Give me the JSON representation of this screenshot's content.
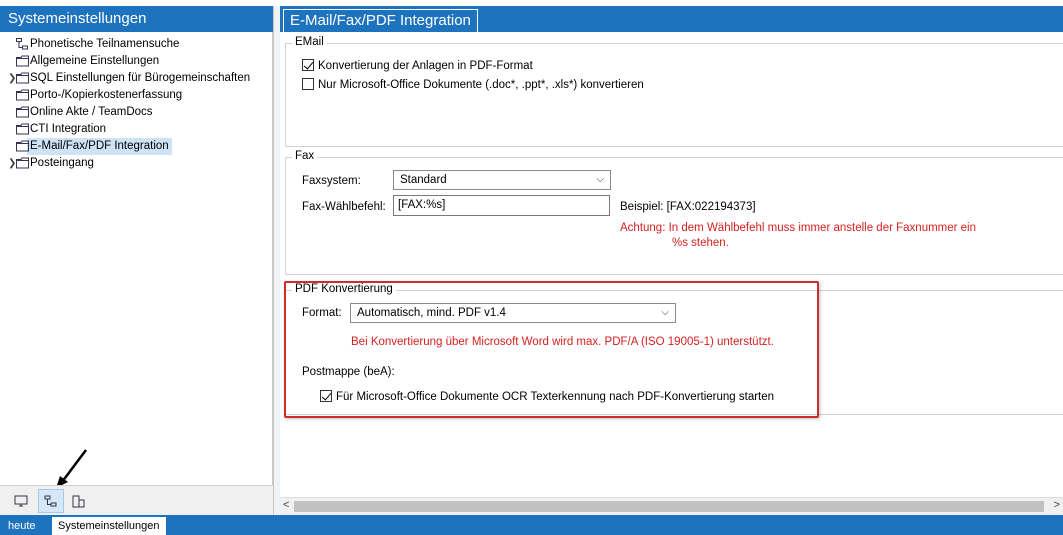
{
  "left": {
    "title": "Systemeinstellungen",
    "tree": [
      {
        "label": "Phonetische Teilnamensuche",
        "icon": "tree-icon",
        "chevron": false
      },
      {
        "label": "Allgemeine Einstellungen",
        "icon": "folder-icon",
        "chevron": false
      },
      {
        "label": "SQL Einstellungen für Bürogemeinschaften",
        "icon": "folder-icon",
        "chevron": true
      },
      {
        "label": "Porto-/Kopierkostenerfassung",
        "icon": "folder-icon",
        "chevron": false
      },
      {
        "label": "Online Akte / TeamDocs",
        "icon": "folder-icon",
        "chevron": false
      },
      {
        "label": "CTI Integration",
        "icon": "folder-icon",
        "chevron": false
      },
      {
        "label": "E-Mail/Fax/PDF Integration",
        "icon": "folder-icon",
        "chevron": false,
        "selected": true
      },
      {
        "label": "Posteingang",
        "icon": "folder-icon",
        "chevron": true
      }
    ],
    "bottom_tabs": [
      "monitor-icon",
      "tree-icon",
      "document-tree-icon"
    ]
  },
  "right": {
    "tab_title": "E-Mail/Fax/PDF Integration",
    "email": {
      "title": "EMail",
      "convert_attachments": {
        "label": "Konvertierung der Anlagen in PDF-Format",
        "checked": true
      },
      "office_only": {
        "label": "Nur Microsoft-Office Dokumente (.doc*, .ppt*, .xls*) konvertieren",
        "checked": false
      }
    },
    "fax": {
      "title": "Fax",
      "system_label": "Faxsystem:",
      "system_value": "Standard",
      "dial_label": "Fax-Wählbefehl:",
      "dial_value": "[FAX:%s]",
      "example": "Beispiel: [FAX:022194373]",
      "warning_line1": "Achtung:  In dem Wählbefehl muss immer anstelle der Faxnummer ein",
      "warning_line2": "%s stehen."
    },
    "pdf": {
      "title": "PDF Konvertierung",
      "format_label": "Format:",
      "format_value": "Automatisch, mind. PDF v1.4",
      "note": "Bei Konvertierung über Microsoft Word wird max. PDF/A (ISO 19005-1) unterstützt.",
      "postmappe_label": "Postmappe (beA):",
      "ocr": {
        "label": "Für Microsoft-Office Dokumente OCR Texterkennung nach PDF-Konvertierung starten",
        "checked": true
      }
    },
    "scroll_left": "<",
    "scroll_right": ">"
  },
  "statusbar": {
    "items": [
      "heute",
      "Systemeinstellungen"
    ]
  },
  "colors": {
    "accent": "#1e73be",
    "highlight_border": "#c9302c",
    "warning": "#d62020"
  }
}
